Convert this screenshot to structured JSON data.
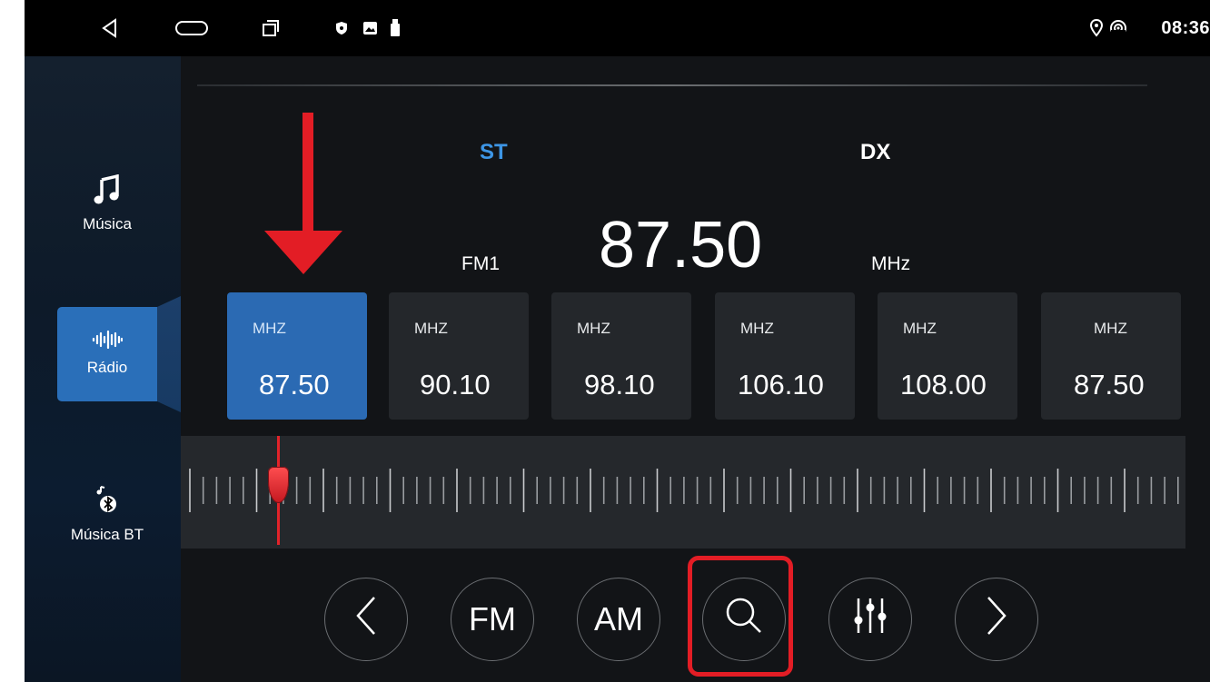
{
  "status_bar": {
    "time": "08:36",
    "nav_icons": [
      "back-icon",
      "home-icon",
      "recents-icon"
    ],
    "notification_icons": [
      "shield-icon",
      "image-icon",
      "usb-icon"
    ],
    "status_icons": [
      "location-icon",
      "hotspot-icon"
    ]
  },
  "sidebar": {
    "items": [
      {
        "label": "Música",
        "icon": "music-note-icon",
        "active": false
      },
      {
        "label": "Rádio",
        "icon": "sound-wave-icon",
        "active": true
      },
      {
        "label": "Música BT",
        "icon": "bluetooth-music-icon",
        "active": false
      }
    ]
  },
  "radio": {
    "st_label": "ST",
    "dx_label": "DX",
    "band": "FM1",
    "frequency": "87.50",
    "unit": "MHz",
    "st_color": "#3d96e6"
  },
  "presets": [
    {
      "unit": "MHZ",
      "freq": "87.50",
      "active": true
    },
    {
      "unit": "MHZ",
      "freq": "90.10",
      "active": false
    },
    {
      "unit": "MHZ",
      "freq": "98.10",
      "active": false
    },
    {
      "unit": "MHZ",
      "freq": "106.10",
      "active": false
    },
    {
      "unit": "MHZ",
      "freq": "108.00",
      "active": false
    },
    {
      "unit": "MHZ",
      "freq": "87.50",
      "active": false
    }
  ],
  "controls": {
    "prev_icon": "chevron-left-icon",
    "fm_label": "FM",
    "am_label": "AM",
    "search_icon": "search-icon",
    "eq_icon": "equalizer-icon",
    "next_icon": "chevron-right-icon"
  },
  "colors": {
    "accent": "#2b6ab3",
    "annotation": "#e31d25",
    "needle": "#e2232a"
  }
}
